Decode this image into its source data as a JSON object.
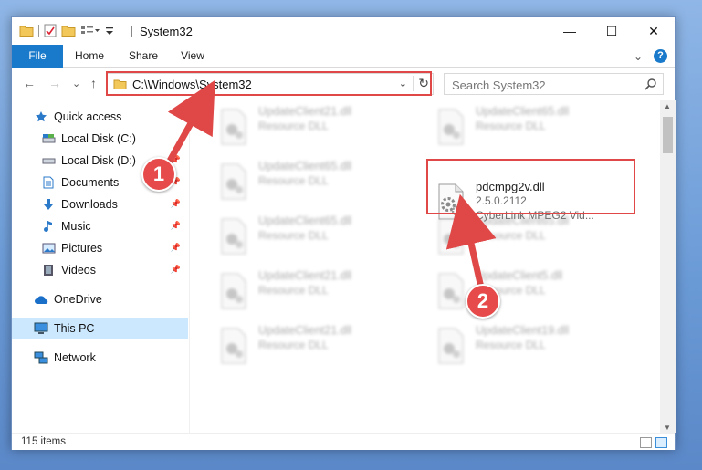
{
  "window": {
    "title": "System32",
    "controls": {
      "minimize": "—",
      "maximize": "☐",
      "close": "✕"
    }
  },
  "ribbon": {
    "tabs": [
      "File",
      "Home",
      "Share",
      "View"
    ],
    "help": "?",
    "collapse": "⌄"
  },
  "nav": {
    "back": "←",
    "forward": "→",
    "recent": "⌄",
    "up": "↑",
    "address": "C:\\Windows\\System32",
    "address_dropdown": "⌄",
    "refresh": "↻",
    "search_placeholder": "Search System32"
  },
  "sidebar": {
    "items": [
      {
        "label": "Quick access",
        "icon": "star-icon",
        "pinned": false
      },
      {
        "label": "Local Disk (C:)",
        "icon": "drive-icon",
        "pinned": false
      },
      {
        "label": "Local Disk (D:)",
        "icon": "drive-icon",
        "pinned": true
      },
      {
        "label": "Documents",
        "icon": "documents-icon",
        "pinned": true
      },
      {
        "label": "Downloads",
        "icon": "downloads-icon",
        "pinned": true
      },
      {
        "label": "Music",
        "icon": "music-icon",
        "pinned": true
      },
      {
        "label": "Pictures",
        "icon": "pictures-icon",
        "pinned": true
      },
      {
        "label": "Videos",
        "icon": "videos-icon",
        "pinned": true
      },
      {
        "label": "OneDrive",
        "icon": "onedrive-icon",
        "pinned": false
      },
      {
        "label": "This PC",
        "icon": "pc-icon",
        "pinned": false,
        "selected": true
      },
      {
        "label": "Network",
        "icon": "network-icon",
        "pinned": false
      }
    ]
  },
  "files": [
    {
      "name": "UpdateClient21.dll",
      "desc": "Resource DLL",
      "blurred": true
    },
    {
      "name": "UpdateClient65.dll",
      "desc": "Resource DLL",
      "blurred": true
    },
    {
      "name": "UpdateClient65.dll",
      "desc": "Resource DLL",
      "blurred": true
    },
    {
      "name": "pdcmpg2v.dll",
      "version": "2.5.0.2112",
      "desc": "CyberLink MPEG2 Vid...",
      "blurred": false
    },
    {
      "name": "UpdateClient65.dll",
      "desc": "Resource DLL",
      "blurred": true
    },
    {
      "name": "UpdateClient65.dll",
      "desc": "Resource DLL",
      "blurred": true
    },
    {
      "name": "UpdateClient21.dll",
      "desc": "Resource DLL",
      "blurred": true
    },
    {
      "name": "UpdateClient5.dll",
      "desc": "Resource DLL",
      "blurred": true
    },
    {
      "name": "UpdateClient21.dll",
      "desc": "Resource DLL",
      "blurred": true
    },
    {
      "name": "UpdateClient19.dll",
      "desc": "Resource DLL",
      "blurred": true
    }
  ],
  "status": {
    "count": "115 items"
  },
  "annotations": {
    "step1": "1",
    "step2": "2",
    "color": "#e04848"
  }
}
